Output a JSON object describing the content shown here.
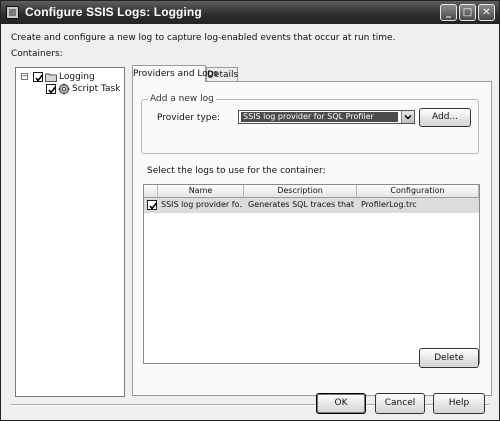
{
  "window": {
    "title": "Configure SSIS Logs: Logging",
    "controls": {
      "minimize": "_",
      "maximize": "□",
      "close": "✕"
    }
  },
  "intro_text": "Create and configure a new log to capture log-enabled events that occur at run time.",
  "containers": {
    "label": "Containers:",
    "tree": [
      {
        "label": "Logging",
        "checked": true,
        "expanded": true,
        "icon": "folder-icon"
      },
      {
        "label": "Script Task",
        "checked": true,
        "icon": "script-task-icon"
      }
    ]
  },
  "tabs": [
    {
      "label": "Providers and Logs",
      "active": true
    },
    {
      "label": "Details",
      "active": false
    }
  ],
  "add_log": {
    "group_label": "Add a new log",
    "provider_type_label": "Provider type:",
    "provider_type_value": "SSIS log provider for SQL Profiler",
    "add_button": "Add..."
  },
  "logs": {
    "instruction": "Select the logs to use for the container:",
    "columns": [
      "Name",
      "Description",
      "Configuration"
    ],
    "rows": [
      {
        "checked": true,
        "name": "SSIS log provider fo...",
        "description": "Generates SQL traces that ...",
        "configuration": "ProfilerLog.trc"
      }
    ],
    "delete_button": "Delete"
  },
  "footer": {
    "ok": "OK",
    "cancel": "Cancel",
    "help": "Help"
  }
}
